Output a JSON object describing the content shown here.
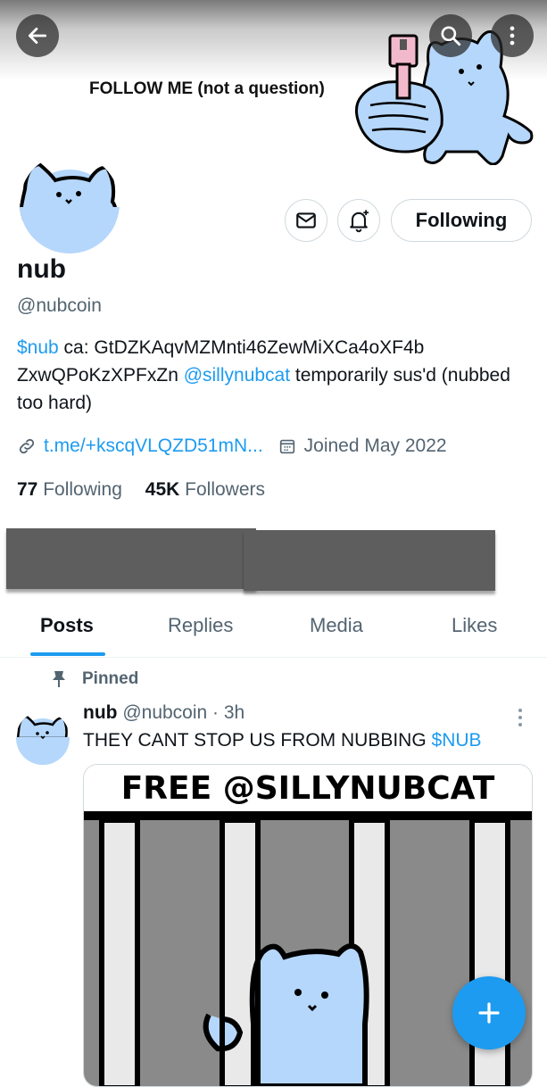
{
  "header": {
    "banner_text": "FOLLOW ME (not a question)"
  },
  "profile": {
    "name": "nub",
    "handle": "@nubcoin",
    "bio_ticker": "$nub",
    "bio_ca": " ca: GtDZKAqvMZMnti46ZewMiXCa4oXF4b ZxwQPoKzXPFxZn ",
    "bio_mention": "@sillynubcat",
    "bio_tail": " temporarily sus'd (nubbed too hard)",
    "link": "t.me/+kscqVLQZD51mN...",
    "joined": "Joined May 2022",
    "following_count": "77",
    "following_label": "Following",
    "followers_count": "45K",
    "followers_label": "Followers",
    "follow_button_label": "Following"
  },
  "tabs": [
    {
      "label": "Posts",
      "active": true
    },
    {
      "label": "Replies",
      "active": false
    },
    {
      "label": "Media",
      "active": false
    },
    {
      "label": "Likes",
      "active": false
    }
  ],
  "post": {
    "pinned_label": "Pinned",
    "author_name": "nub",
    "author_handle": "@nubcoin · 3h",
    "text_main": "THEY CANT STOP US FROM NUBBING ",
    "text_ticker": "$NUB",
    "image_caption": "FREE @SILLYNUBCAT"
  },
  "colors": {
    "accent": "#1d9bf0",
    "cat_fill": "#b5d7fb",
    "hand_pink": "#f2b9cc",
    "muted_text": "#536471"
  }
}
